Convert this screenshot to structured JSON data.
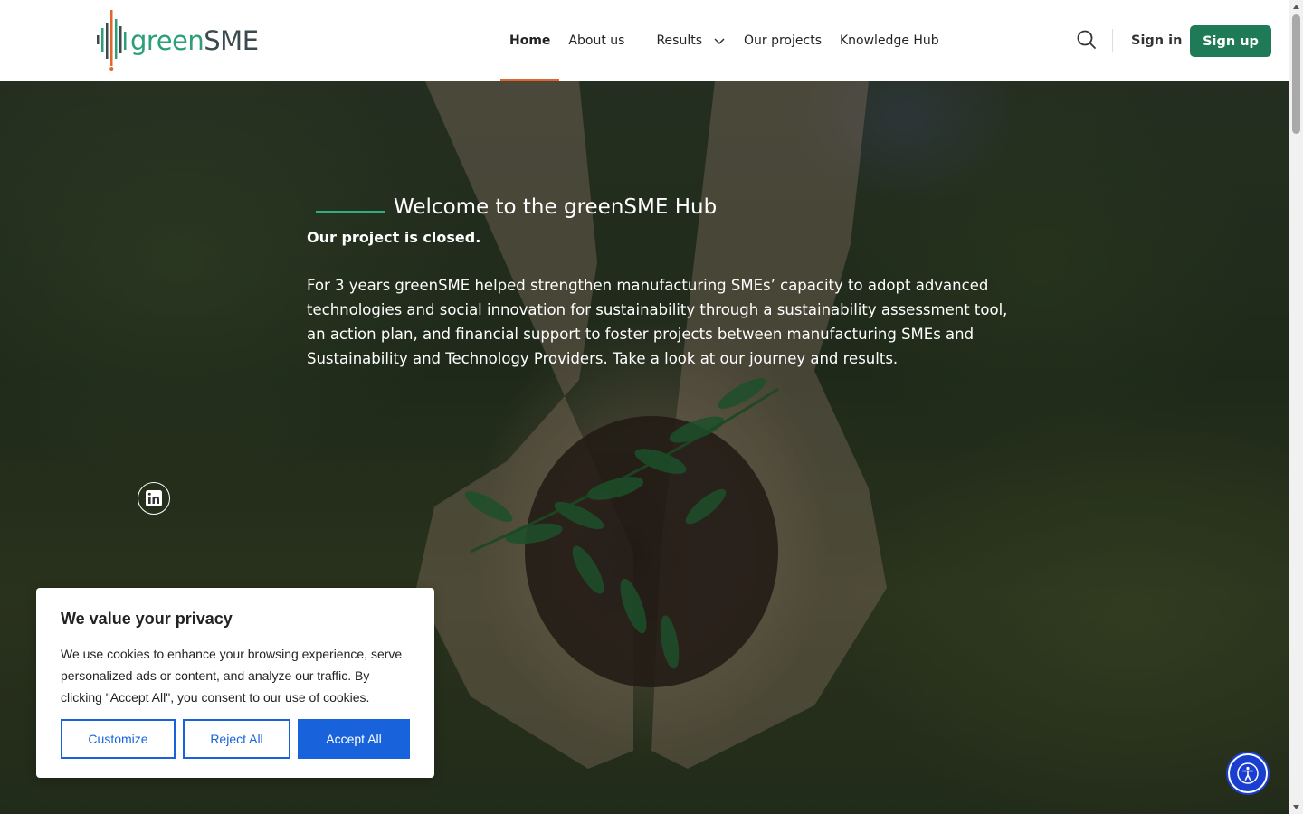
{
  "brand": {
    "name_part1": "green",
    "name_part2": "SME",
    "color_green": "#2c9f76",
    "color_dark": "#3b4a4f",
    "accent": "#e0662b"
  },
  "nav": {
    "items": [
      {
        "label": "Home",
        "active": true
      },
      {
        "label": "About us"
      },
      {
        "label": "Results",
        "has_dropdown": true
      },
      {
        "label": "Our projects"
      },
      {
        "label": "Knowledge Hub"
      }
    ]
  },
  "header": {
    "search_icon": "search-icon",
    "sign_in": "Sign in",
    "sign_up": "Sign up",
    "sign_up_color": "#1f7a58"
  },
  "hero": {
    "welcome": "Welcome to the greenSME Hub",
    "closed": "Our project is closed.",
    "description": "For 3 years greenSME helped strengthen manufacturing SMEs’ capacity to adopt advanced technologies and social innovation for sustainability through a sustainability assessment tool, an action plan, and financial support to foster projects between manufacturing SMEs and Sustainability and Technology Providers. Take a look at our journey and results.",
    "social_icon": "linkedin-icon"
  },
  "cookie": {
    "title": "We value your privacy",
    "text": "We use cookies to enhance your browsing experience, serve personalized ads or content, and analyze our traffic. By clicking \"Accept All\", you consent to our use of cookies.",
    "customize": "Customize",
    "reject": "Reject All",
    "accept": "Accept All",
    "button_color": "#1863dc"
  },
  "accessibility": {
    "icon": "accessibility-icon",
    "color": "#1a3fd0"
  }
}
